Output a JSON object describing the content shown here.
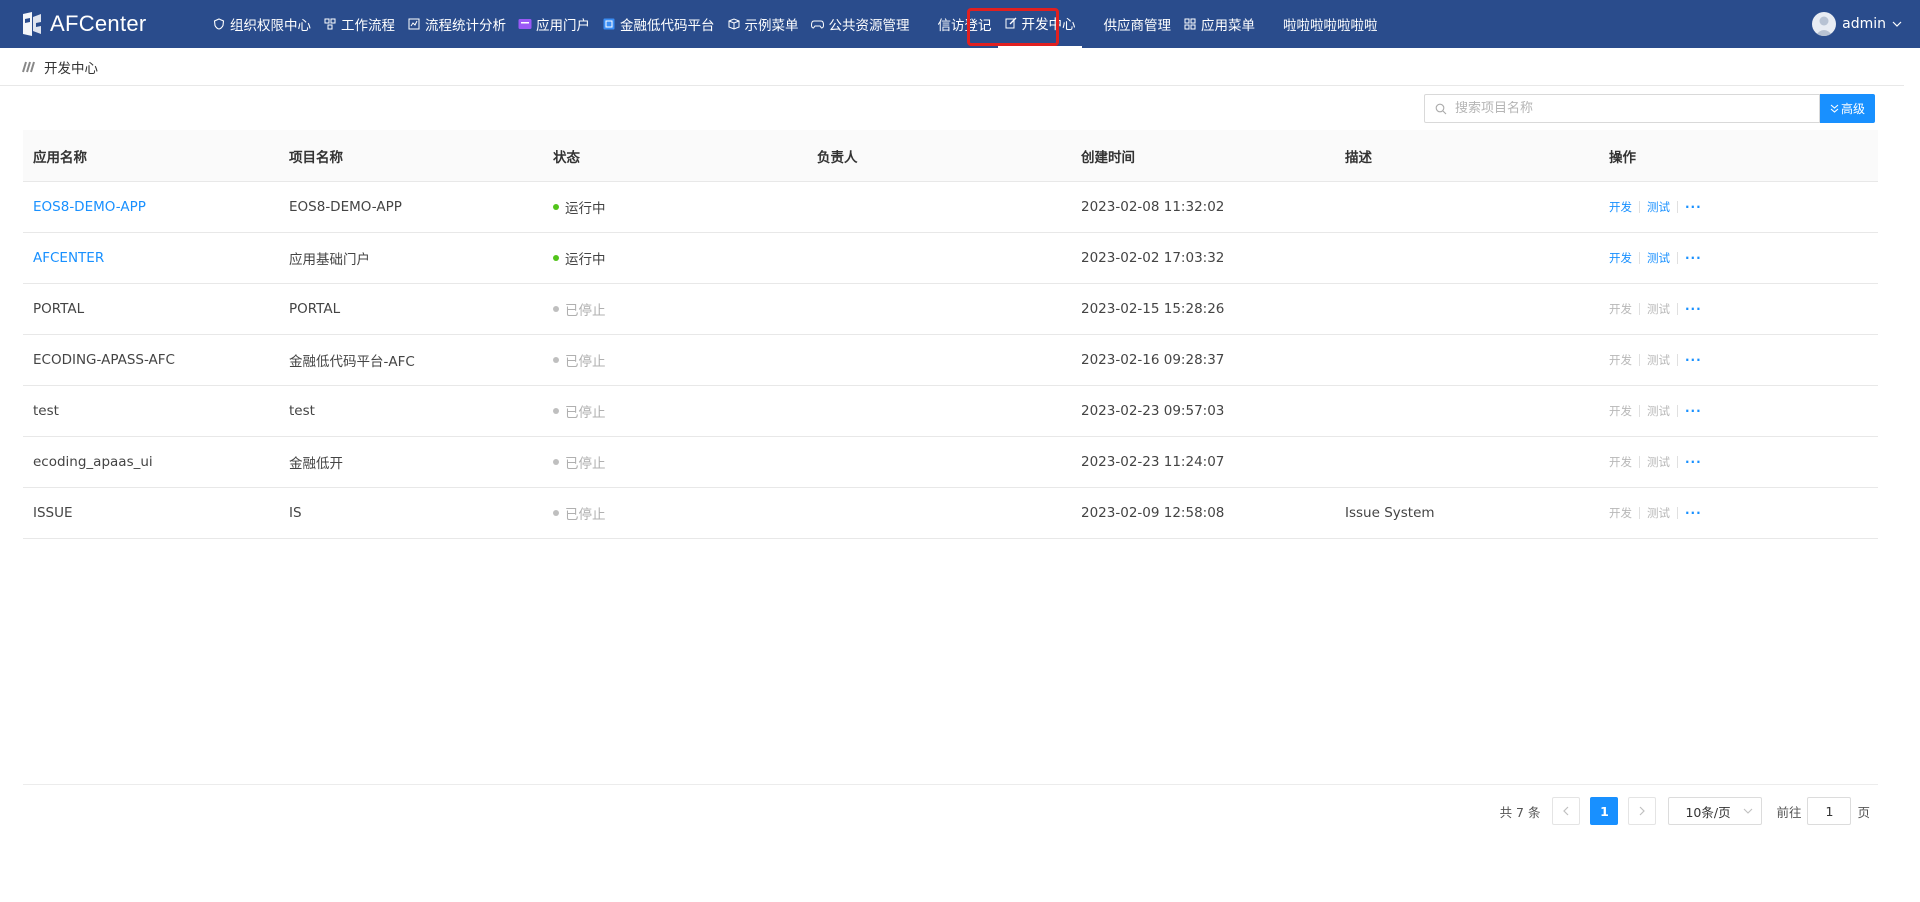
{
  "app": {
    "brand": "AFCenter"
  },
  "nav": {
    "items": [
      {
        "label": "组织权限中心",
        "icon": "shield-icon"
      },
      {
        "label": "工作流程",
        "icon": "workflow-icon"
      },
      {
        "label": "流程统计分析",
        "icon": "chart-icon"
      },
      {
        "label": "应用门户",
        "icon": "portal-icon"
      },
      {
        "label": "金融低代码平台",
        "icon": "lowcode-icon"
      },
      {
        "label": "示例菜单",
        "icon": "box-icon"
      },
      {
        "label": "公共资源管理",
        "icon": "gamepad-icon"
      },
      {
        "label": "信访登记",
        "icon": ""
      },
      {
        "label": "开发中心",
        "icon": "edit-icon"
      },
      {
        "label": "供应商管理",
        "icon": ""
      },
      {
        "label": "应用菜单",
        "icon": "grid-icon"
      },
      {
        "label": "啦啦啦啦啦啦啦",
        "icon": ""
      }
    ],
    "active_index": 8
  },
  "user": {
    "name": "admin"
  },
  "breadcrumb": {
    "current": "开发中心"
  },
  "search": {
    "placeholder": "搜索项目名称",
    "value": "",
    "advanced_label": "高级"
  },
  "table": {
    "columns": [
      "应用名称",
      "项目名称",
      "状态",
      "负责人",
      "创建时间",
      "描述",
      "操作"
    ],
    "rows": [
      {
        "app": "EOS8-DEMO-APP",
        "project": "EOS8-DEMO-APP",
        "status": "运行中",
        "owner": "",
        "created": "2023-02-08 11:32:02",
        "desc": "",
        "running": true
      },
      {
        "app": "AFCENTER",
        "project": "应用基础门户",
        "status": "运行中",
        "owner": "",
        "created": "2023-02-02 17:03:32",
        "desc": "",
        "running": true
      },
      {
        "app": "PORTAL",
        "project": "PORTAL",
        "status": "已停止",
        "owner": "",
        "created": "2023-02-15 15:28:26",
        "desc": "",
        "running": false
      },
      {
        "app": "ECODING-APASS-AFC",
        "project": "金融低代码平台-AFC",
        "status": "已停止",
        "owner": "",
        "created": "2023-02-16 09:28:37",
        "desc": "",
        "running": false
      },
      {
        "app": "test",
        "project": "test",
        "status": "已停止",
        "owner": "",
        "created": "2023-02-23 09:57:03",
        "desc": "",
        "running": false
      },
      {
        "app": "ecoding_apaas_ui",
        "project": "金融低开",
        "status": "已停止",
        "owner": "",
        "created": "2023-02-23 11:24:07",
        "desc": "",
        "running": false
      },
      {
        "app": "ISSUE",
        "project": "IS",
        "status": "已停止",
        "owner": "",
        "created": "2023-02-09 12:58:08",
        "desc": "Issue System",
        "running": false
      }
    ],
    "op_labels": {
      "develop": "开发",
      "test": "测试",
      "more": "···"
    }
  },
  "pagination": {
    "total_text": "共 7 条",
    "current_page": "1",
    "page_size": "10条/页",
    "goto_label": "前往",
    "goto_value": "1",
    "page_suffix": "页"
  },
  "colors": {
    "nav_bg": "#2a4c8c",
    "primary": "#1890ff",
    "running": "#52c41a",
    "stopped": "#bfbfbf",
    "highlight": "#e02020"
  }
}
